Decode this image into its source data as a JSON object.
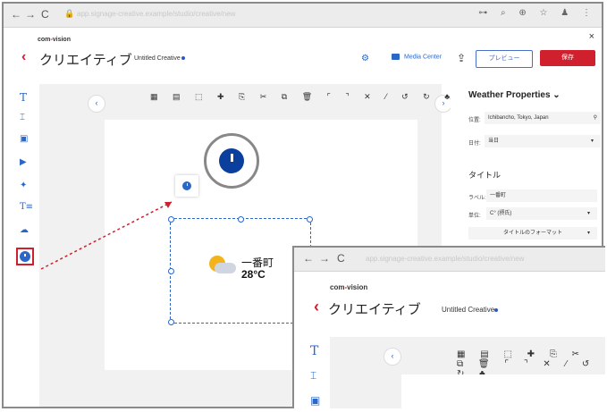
{
  "browser": {
    "nav": [
      "←",
      "→",
      "C"
    ],
    "url": "app.signage-creative.example/studio/creative/new",
    "icons": "⊶ ⌕ ⊕ ☆ ♟ ⋮"
  },
  "app": {
    "logo_prefix": "com",
    "logo_suffix": "vision",
    "title": "クリエイティブ",
    "doc": "Untitled Creative",
    "media_center": "Media Center",
    "preview": "プレビュー",
    "save": "保存",
    "close": "×"
  },
  "toolbar_icons": "▦ ▤ ⬚ ✚ ⎘ ✂ ⧉ 🗑 ⌜ ⌝ ✕ ⁄ ↺ ↻ ♣",
  "widget": {
    "name": "一番町",
    "temp": "28°C"
  },
  "panel": {
    "title": "Weather Properties",
    "location_label": "位置:",
    "location_value": "Ichibancho, Tokyo, Japan",
    "day_label": "日付:",
    "day_value": "当日",
    "section_title": "タイトル",
    "label_label": "ラベル:",
    "label_value": "一番町",
    "unit_label": "単位:",
    "unit_value": "C° (摂氏)",
    "format_button": "タイトルのフォーマット"
  },
  "colors": {
    "accent": "#2a67c9",
    "brand_red": "#d0202e"
  }
}
